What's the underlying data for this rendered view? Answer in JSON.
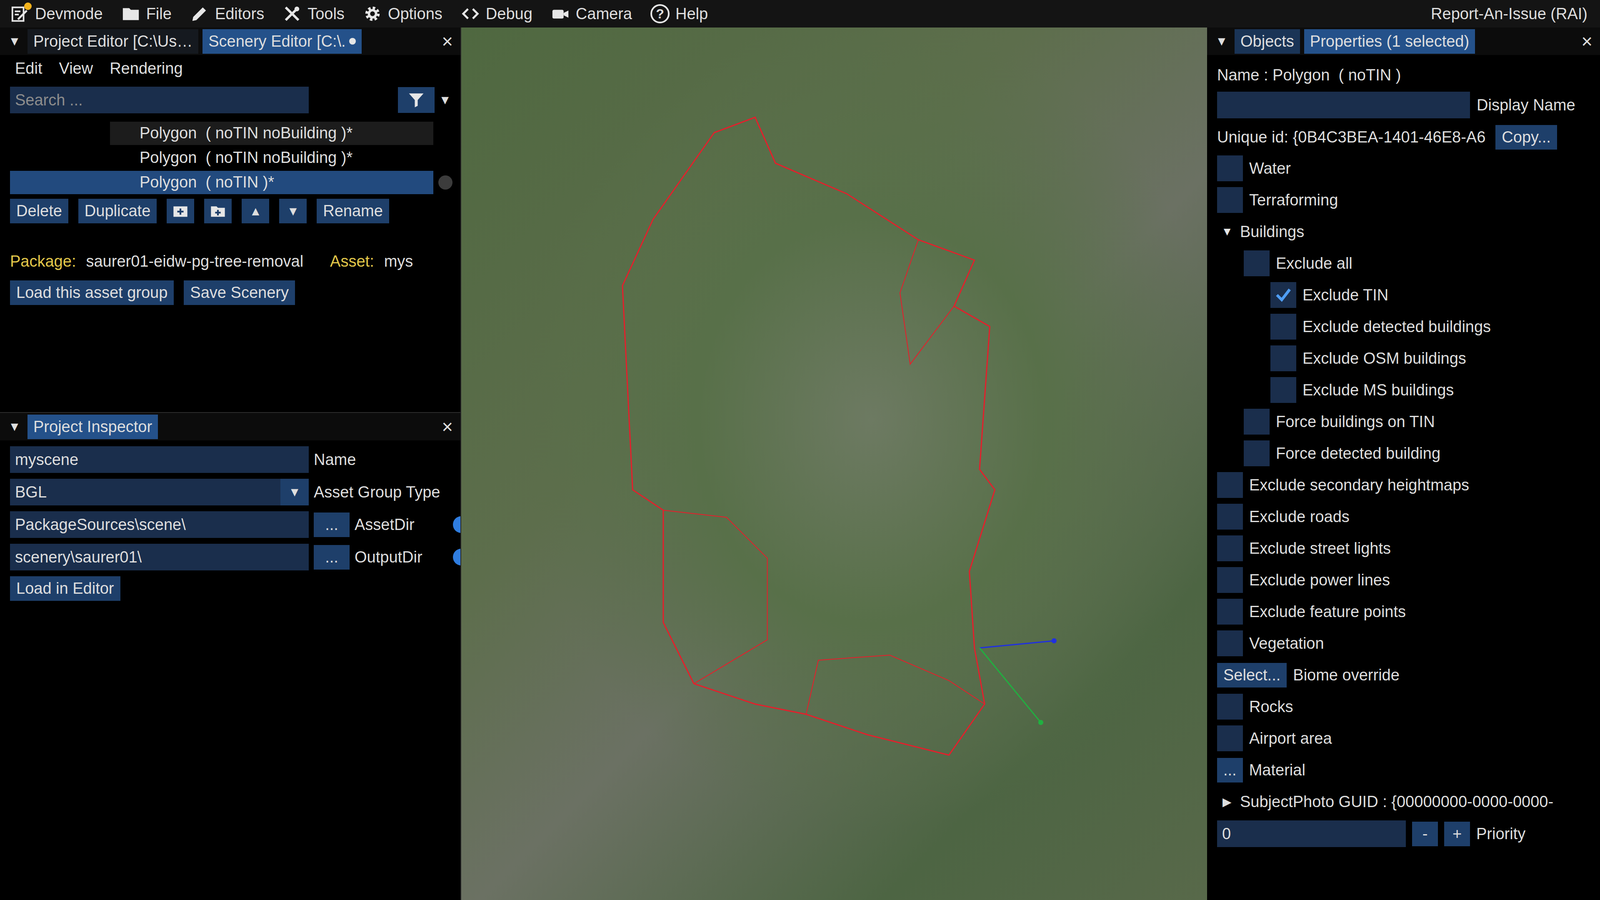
{
  "menu_bar": {
    "items": [
      {
        "label": "Devmode",
        "notification": true
      },
      {
        "label": "File"
      },
      {
        "label": "Editors"
      },
      {
        "label": "Tools"
      },
      {
        "label": "Options"
      },
      {
        "label": "Debug"
      },
      {
        "label": "Camera"
      },
      {
        "label": "Help",
        "glyph": "?"
      }
    ],
    "right": "Report-An-Issue (RAI)"
  },
  "left_panel": {
    "collapse": "▼",
    "tabs": [
      {
        "label": "Project Editor [C:\\Us…",
        "selected": false,
        "unsaved": false
      },
      {
        "label": "Scenery Editor [C:\\.",
        "selected": true,
        "unsaved": true
      }
    ],
    "close": "×",
    "menu": [
      "Edit",
      "View",
      "Rendering"
    ],
    "search": {
      "placeholder": "Search ...",
      "value": "",
      "arrow": "▼"
    },
    "list": [
      {
        "label": "Polygon  ( noTIN noBuilding )*",
        "selected": false,
        "hovered": true
      },
      {
        "label": "Polygon  ( noTIN noBuilding )*",
        "selected": false,
        "hovered": false
      },
      {
        "label": "Polygon  ( noTIN )*",
        "selected": true,
        "hovered": false
      }
    ],
    "buttons": {
      "delete": "Delete",
      "duplicate": "Duplicate",
      "up": "▲",
      "down": "▼",
      "rename": "Rename"
    },
    "package": {
      "label": "Package:",
      "value": "saurer01-eidw-pg-tree-removal",
      "asset_label": "Asset:",
      "asset_value": "mys"
    },
    "actions": [
      "Load this asset group",
      "Save Scenery"
    ]
  },
  "inspector": {
    "collapse": "▼",
    "title": "Project Inspector",
    "close": "×",
    "fields": [
      {
        "kind": "text",
        "value": "myscene",
        "label": "Name"
      },
      {
        "kind": "dropdown",
        "value": "BGL",
        "arrow": "▼",
        "label": "Asset Group Type"
      },
      {
        "kind": "path",
        "value": "PackageSources\\scene\\",
        "button": "...",
        "label": "AssetDir",
        "info": true
      },
      {
        "kind": "path",
        "value": "scenery\\saurer01\\",
        "button": "...",
        "label": "OutputDir",
        "info": true
      }
    ],
    "load_button": "Load in Editor"
  },
  "right_panel": {
    "collapse": "▼",
    "tabs": [
      {
        "label": "Objects",
        "selected": false
      },
      {
        "label": "Properties (1 selected)",
        "selected": true
      }
    ],
    "close": "×",
    "name": "Name : Polygon  ( noTIN )",
    "display_name": {
      "value": "",
      "label": "Display Name"
    },
    "unique_id": {
      "label": "Unique id: {0B4C3BEA-1401-46E8-A6",
      "button": "Copy..."
    },
    "rows": [
      {
        "kind": "checkbox",
        "label": "Water",
        "checked": false,
        "depth": 0
      },
      {
        "kind": "checkbox",
        "label": "Terraforming",
        "checked": false,
        "depth": 0
      },
      {
        "kind": "group",
        "label": "Buildings",
        "arrow": "▼",
        "expanded": true,
        "depth": 0
      },
      {
        "kind": "checkbox",
        "label": "Exclude all",
        "checked": false,
        "depth": 1
      },
      {
        "kind": "checkbox",
        "label": "Exclude TIN",
        "checked": true,
        "depth": 2
      },
      {
        "kind": "checkbox",
        "label": "Exclude detected buildings",
        "checked": false,
        "depth": 2
      },
      {
        "kind": "checkbox",
        "label": "Exclude OSM buildings",
        "checked": false,
        "depth": 2
      },
      {
        "kind": "checkbox",
        "label": "Exclude MS buildings",
        "checked": false,
        "depth": 2
      },
      {
        "kind": "checkbox",
        "label": "Force buildings on TIN",
        "checked": false,
        "depth": 1
      },
      {
        "kind": "checkbox",
        "label": "Force detected building",
        "checked": false,
        "depth": 1
      },
      {
        "kind": "checkbox",
        "label": "Exclude secondary heightmaps",
        "checked": false,
        "depth": 0
      },
      {
        "kind": "checkbox",
        "label": "Exclude roads",
        "checked": false,
        "depth": 0
      },
      {
        "kind": "checkbox",
        "label": "Exclude street lights",
        "checked": false,
        "depth": 0
      },
      {
        "kind": "checkbox",
        "label": "Exclude power lines",
        "checked": false,
        "depth": 0
      },
      {
        "kind": "checkbox",
        "label": "Exclude feature points",
        "checked": false,
        "depth": 0
      },
      {
        "kind": "checkbox",
        "label": "Vegetation",
        "checked": false,
        "depth": 0
      },
      {
        "kind": "button",
        "button": "Select...",
        "label": "Biome override",
        "depth": 0
      },
      {
        "kind": "checkbox",
        "label": "Rocks",
        "checked": false,
        "depth": 0
      },
      {
        "kind": "checkbox",
        "label": "Airport area",
        "checked": false,
        "depth": 0
      },
      {
        "kind": "button",
        "button": "...",
        "label": "Material",
        "depth": 0
      },
      {
        "kind": "group",
        "label": "SubjectPhoto GUID : {00000000-0000-0000-",
        "arrow": "▶",
        "expanded": false,
        "depth": 0
      },
      {
        "kind": "number",
        "value": "0",
        "minus": "-",
        "plus": "+",
        "label": "Priority",
        "depth": 0
      }
    ]
  }
}
